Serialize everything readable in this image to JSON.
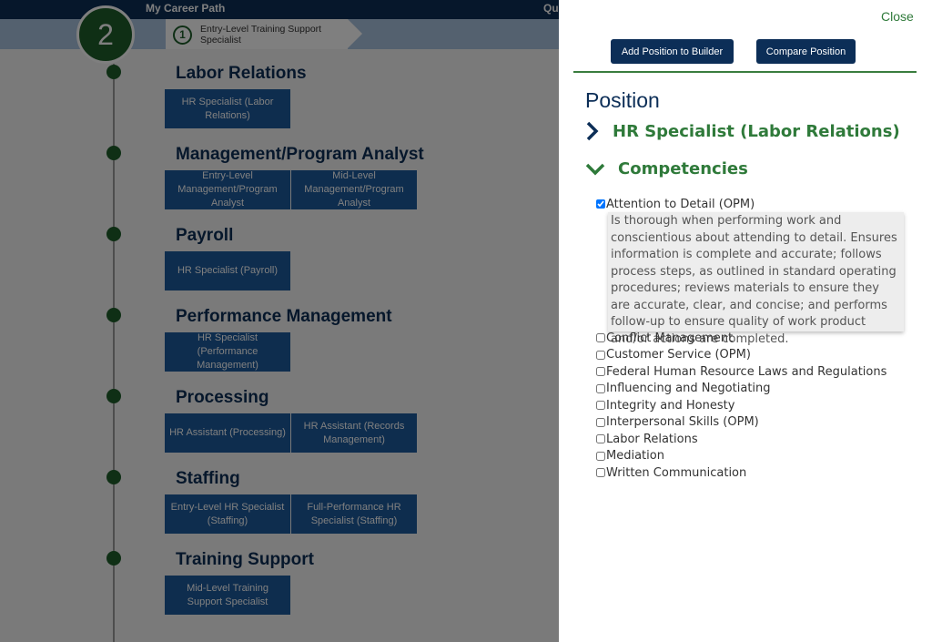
{
  "app": {
    "title": "My Career Path",
    "top_right_partial": "Qu"
  },
  "step": {
    "number": "2"
  },
  "breadcrumb": {
    "number": "1",
    "label": "Entry-Level Training Support Specialist"
  },
  "categories": [
    {
      "title": "Labor Relations",
      "positions": [
        "HR Specialist (Labor Relations)"
      ]
    },
    {
      "title": "Management/Program Analyst",
      "positions": [
        "Entry-Level Management/Program Analyst",
        "Mid-Level Management/Program Analyst"
      ]
    },
    {
      "title": "Payroll",
      "positions": [
        "HR Specialist (Payroll)"
      ]
    },
    {
      "title": "Performance Management",
      "positions": [
        "HR Specialist (Performance Management)"
      ]
    },
    {
      "title": "Processing",
      "positions": [
        "HR Assistant (Processing)",
        "HR Assistant (Records Management)"
      ]
    },
    {
      "title": "Staffing",
      "positions": [
        "Entry-Level HR Specialist (Staffing)",
        "Full-Performance HR Specialist (Staffing)"
      ]
    },
    {
      "title": "Training Support",
      "positions": [
        "Mid-Level Training Support Specialist"
      ]
    }
  ],
  "panel": {
    "close_label": "Close",
    "add_button": "Add Position to Builder",
    "compare_button": "Compare Position",
    "heading": "Position",
    "position_title": "HR Specialist (Labor Relations)",
    "competencies_title": "Competencies",
    "competencies": [
      {
        "label": "Attention to Detail (OPM)",
        "checked": true
      },
      {
        "label": "Conflict Management",
        "checked": false
      },
      {
        "label": "Customer Service (OPM)",
        "checked": false
      },
      {
        "label": "Federal Human Resource Laws and Regulations",
        "checked": false
      },
      {
        "label": "Influencing and Negotiating",
        "checked": false
      },
      {
        "label": "Integrity and Honesty",
        "checked": false
      },
      {
        "label": "Interpersonal Skills (OPM)",
        "checked": false
      },
      {
        "label": "Labor Relations",
        "checked": false
      },
      {
        "label": "Mediation",
        "checked": false
      },
      {
        "label": "Written Communication",
        "checked": false
      }
    ],
    "description": "Is thorough when performing work and conscientious about attending to detail. Ensures information is complete and accurate; follows process steps, as outlined in standard operating procedures; reviews materials to ensure they are accurate, clear, and concise; and performs follow-up to ensure quality of work product and/or actions are completed."
  },
  "colors": {
    "navy": "#0c2e57",
    "green": "#2f7a3a",
    "position_box": "#1d5a9c"
  }
}
